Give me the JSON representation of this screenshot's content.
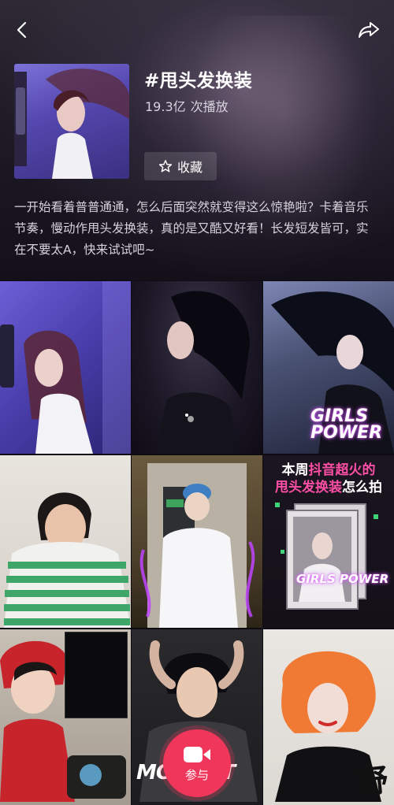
{
  "topic": {
    "title": "#甩头发换装",
    "play_count": "19.3亿",
    "play_unit": "次播放",
    "collect_label": "收藏",
    "description": "一开始看着普普通通，怎么后面突然就变得这么惊艳啦？卡着音乐节奏，慢动作甩头发换装，真的是又酷又好看！长发短发皆可，实在不要太A，快来试试吧~"
  },
  "grid_overlays": {
    "girls_power_1": "GIRLS POWER",
    "hot_line1_a": "本周",
    "hot_line1_b": "抖音超火的",
    "hot_line2_a": "甩头发换装",
    "hot_line2_b": "怎么拍",
    "girls_power_2": "GIRLS POWER",
    "moment": "MOMENT",
    "wild": "野"
  },
  "join_button": {
    "label": "参与"
  },
  "icons": [
    "back-icon",
    "share-icon",
    "star-icon",
    "camera-icon"
  ],
  "colors": {
    "accent": "#f0365a",
    "pink_text": "#ff4fa6"
  }
}
